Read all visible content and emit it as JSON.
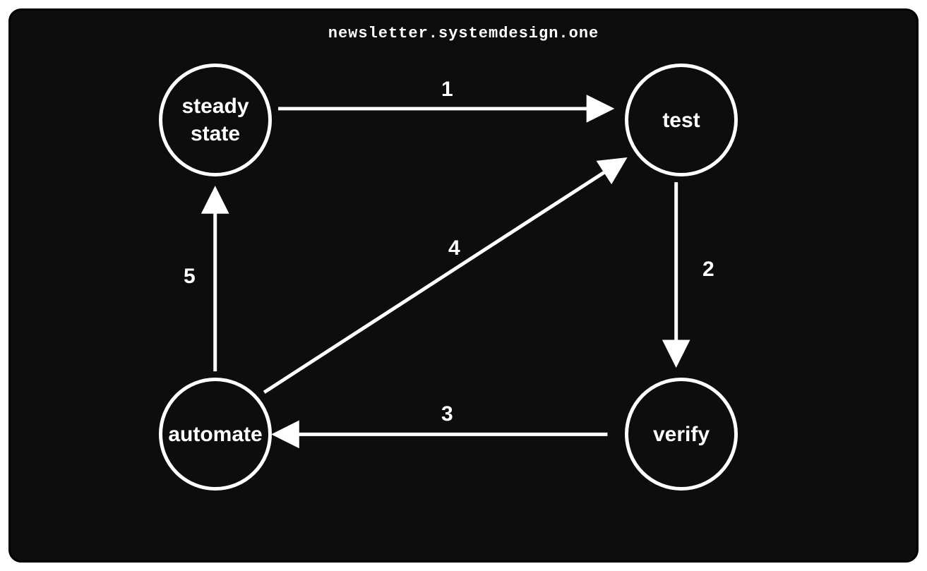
{
  "title": "newsletter.systemdesign.one",
  "nodes": {
    "steady_state": {
      "line1": "steady",
      "line2": "state"
    },
    "test": {
      "label": "test"
    },
    "verify": {
      "label": "verify"
    },
    "automate": {
      "label": "automate"
    }
  },
  "edges": {
    "e1": {
      "label": "1"
    },
    "e2": {
      "label": "2"
    },
    "e3": {
      "label": "3"
    },
    "e4": {
      "label": "4"
    },
    "e5": {
      "label": "5"
    }
  },
  "colors": {
    "bg": "#0d0d0d",
    "stroke": "#ffffff"
  }
}
